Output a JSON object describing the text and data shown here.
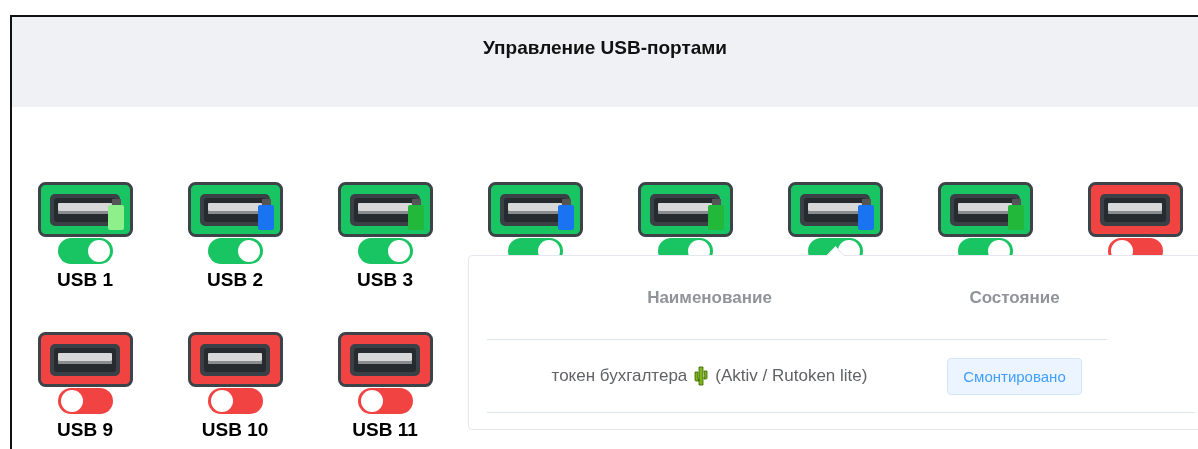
{
  "title": "Управление USB-портами",
  "ports": [
    {
      "label": "USB 1",
      "on": true,
      "color": "#8ef08a"
    },
    {
      "label": "USB 2",
      "on": true,
      "color": "#1a73f0"
    },
    {
      "label": "USB 3",
      "on": true,
      "color": "#22b83a"
    },
    {
      "on": true,
      "color": "#1a73f0"
    },
    {
      "on": true,
      "color": "#22b83a"
    },
    {
      "on": true,
      "color": "#1a73f0"
    },
    {
      "on": true,
      "color": "#22b83a"
    },
    {
      "on": false
    },
    {
      "label": "USB 9",
      "on": false
    },
    {
      "label": "USB 10",
      "on": false
    },
    {
      "label": "USB 11",
      "on": false
    }
  ],
  "popup": {
    "columns": [
      "Наименование",
      "Состояние"
    ],
    "rows": [
      {
        "name": "токен бухгалтера",
        "model": "(Aktiv / Rutoken lite)",
        "status": "Смонтировано"
      }
    ]
  }
}
